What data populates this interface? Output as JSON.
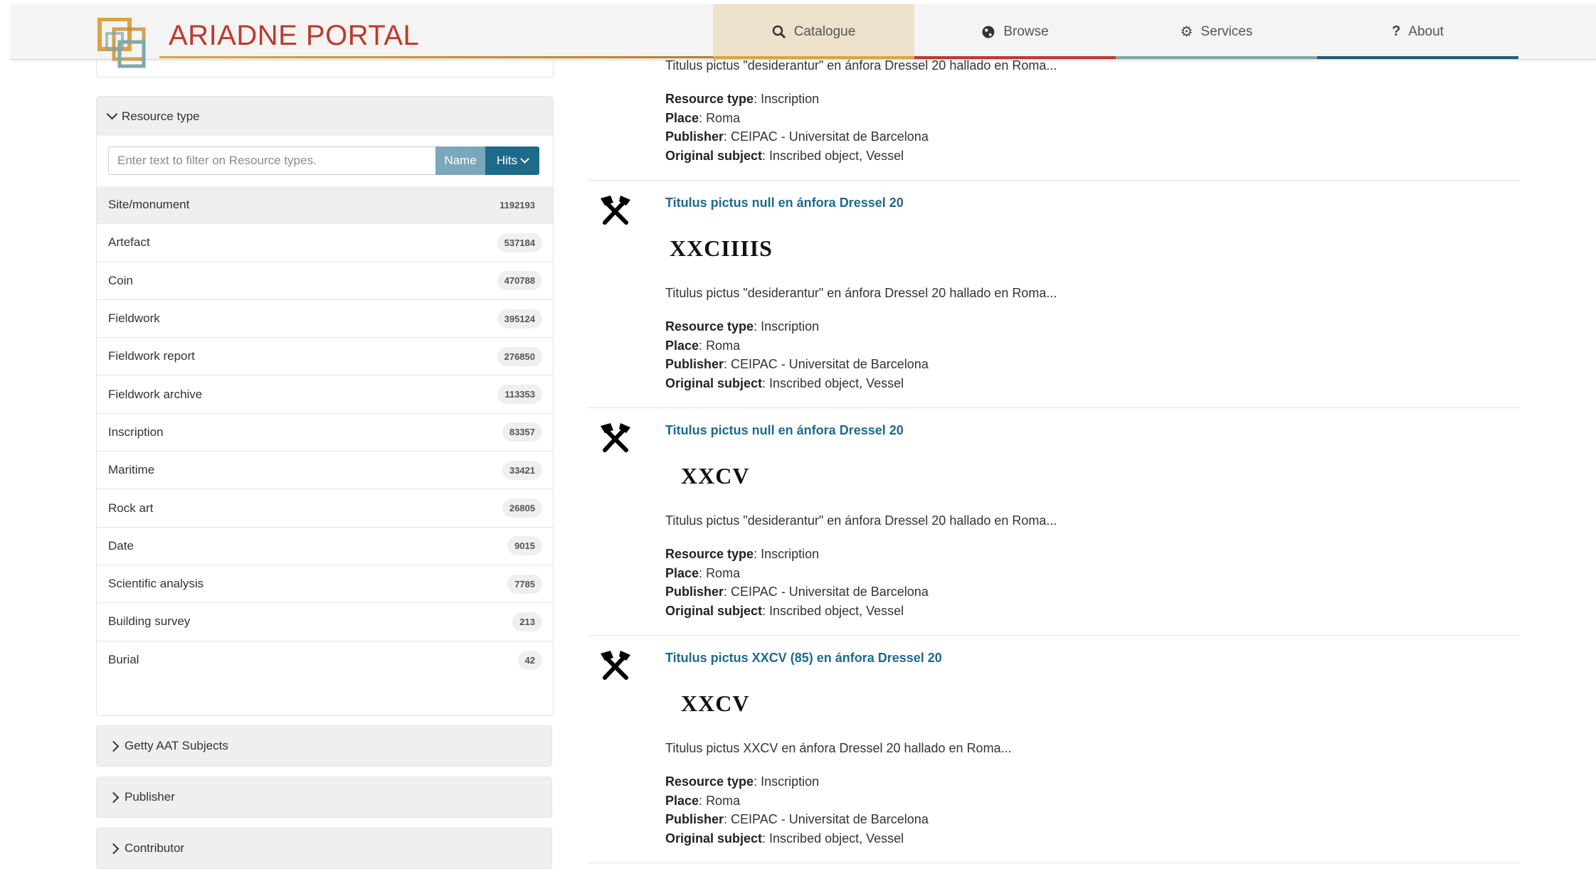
{
  "header": {
    "brand": "ARIADNE PORTAL",
    "nav": [
      {
        "label": "Catalogue",
        "icon": "search-icon",
        "color": "#d9a441"
      },
      {
        "label": "Browse",
        "icon": "globe-icon",
        "color": "#c0392b"
      },
      {
        "label": "Services",
        "icon": "gear-icon",
        "color": "#7fa9a4"
      },
      {
        "label": "About",
        "icon": "question-icon",
        "color": "#1f5a7a"
      }
    ]
  },
  "sidebar": {
    "resource_type": {
      "title": "Resource type",
      "filter_placeholder": "Enter text to filter on Resource types.",
      "sort_name": "Name",
      "sort_hits": "Hits",
      "items": [
        {
          "label": "Site/monument",
          "count": "1192193"
        },
        {
          "label": "Artefact",
          "count": "537184"
        },
        {
          "label": "Coin",
          "count": "470788"
        },
        {
          "label": "Fieldwork",
          "count": "395124"
        },
        {
          "label": "Fieldwork report",
          "count": "276850"
        },
        {
          "label": "Fieldwork archive",
          "count": "113353"
        },
        {
          "label": "Inscription",
          "count": "83357"
        },
        {
          "label": "Maritime",
          "count": "33421"
        },
        {
          "label": "Rock art",
          "count": "26805"
        },
        {
          "label": "Date",
          "count": "9015"
        },
        {
          "label": "Scientific analysis",
          "count": "7785"
        },
        {
          "label": "Building survey",
          "count": "213"
        },
        {
          "label": "Burial",
          "count": "42"
        }
      ]
    },
    "collapsed": [
      "Getty AAT Subjects",
      "Publisher",
      "Contributor"
    ]
  },
  "results": {
    "partial": {
      "desc": "Titulus pictus \"desiderantur\" en ánfora Dressel 20 hallado en Roma...",
      "resource_type": "Inscription",
      "place": "Roma",
      "publisher": "CEIPAC - Universitat de Barcelona",
      "original_subject": "Inscribed object, Vessel"
    },
    "labels": {
      "resource_type": "Resource type",
      "place": "Place",
      "publisher": "Publisher",
      "original_subject": "Original subject"
    },
    "items": [
      {
        "title": "Titulus pictus null en ánfora Dressel 20",
        "inscription": "XXCIIIIS",
        "desc": "Titulus pictus \"desiderantur\" en ánfora Dressel 20 hallado en Roma...",
        "resource_type": "Inscription",
        "place": "Roma",
        "publisher": "CEIPAC - Universitat de Barcelona",
        "original_subject": "Inscribed object, Vessel"
      },
      {
        "title": "Titulus pictus null en ánfora Dressel 20",
        "inscription": "XXCV",
        "desc": "Titulus pictus \"desiderantur\" en ánfora Dressel 20 hallado en Roma...",
        "resource_type": "Inscription",
        "place": "Roma",
        "publisher": "CEIPAC - Universitat de Barcelona",
        "original_subject": "Inscribed object, Vessel"
      },
      {
        "title": "Titulus pictus XXCV (85) en ánfora Dressel 20",
        "inscription": "XXCV",
        "desc": "Titulus pictus XXCV en ánfora Dressel 20 hallado en Roma...",
        "resource_type": "Inscription",
        "place": "Roma",
        "publisher": "CEIPAC - Universitat de Barcelona",
        "original_subject": "Inscribed object, Vessel"
      }
    ]
  }
}
